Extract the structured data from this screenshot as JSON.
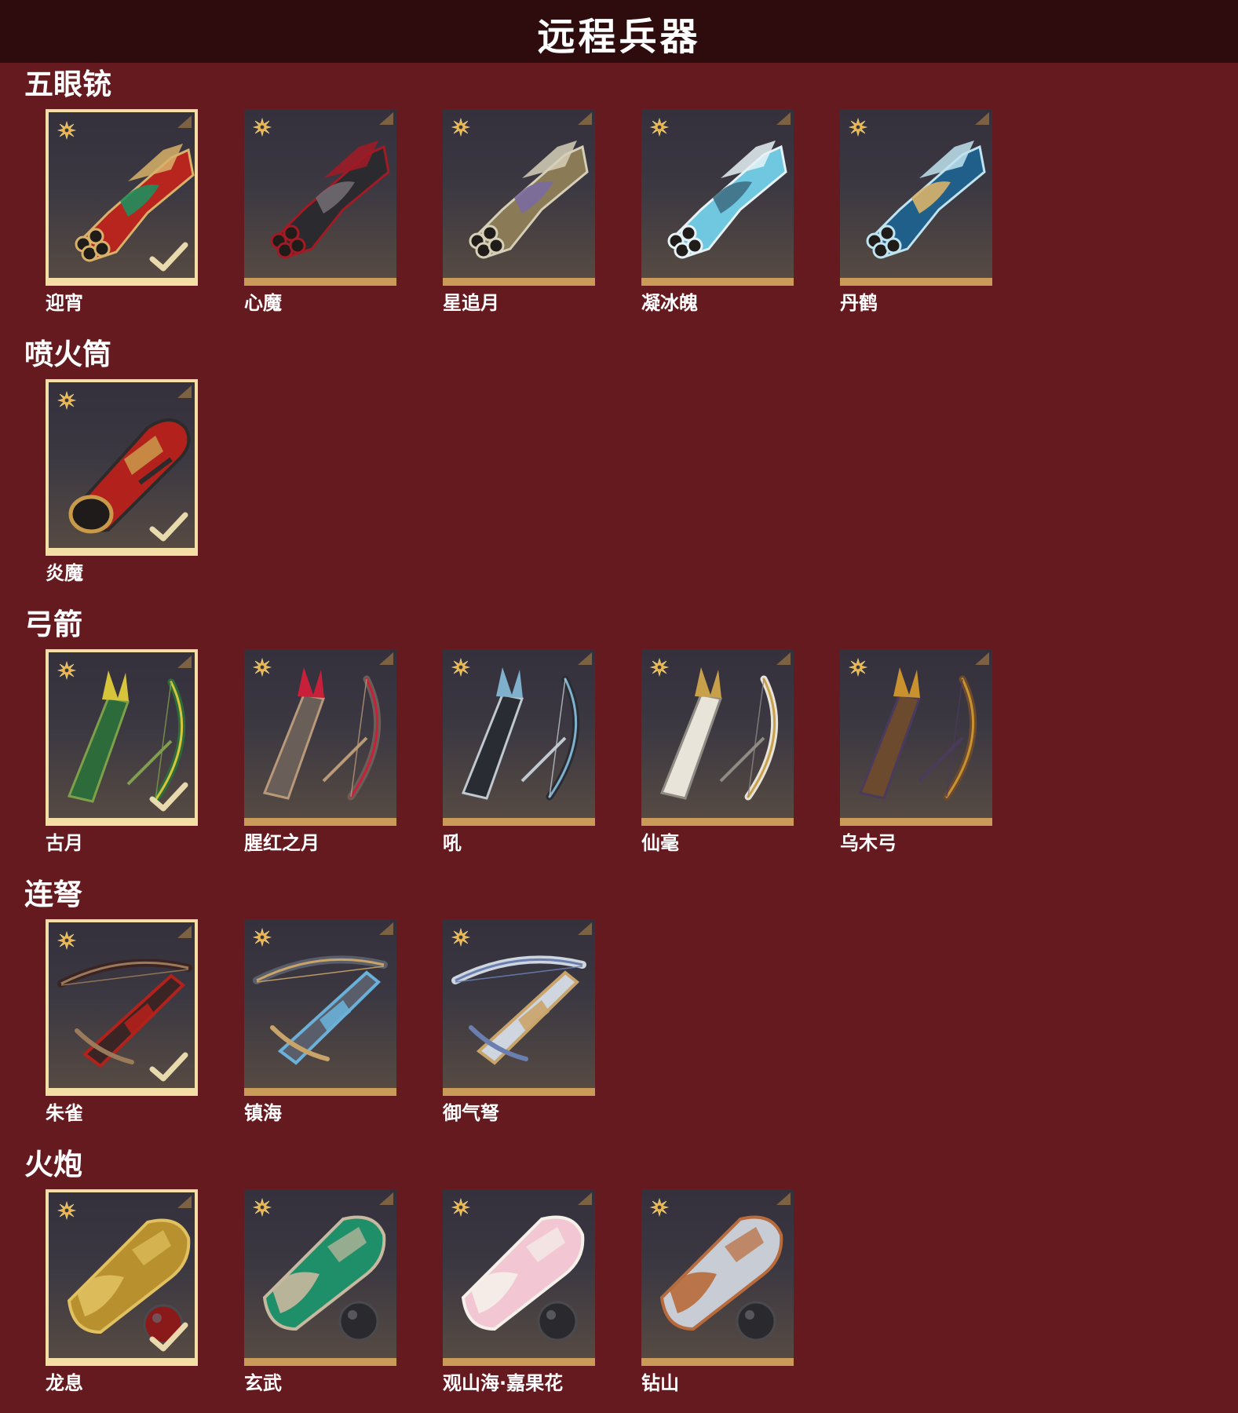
{
  "page": {
    "title": "远程兵器"
  },
  "sections": [
    {
      "title": "五眼铳",
      "items": [
        {
          "name": "迎宵",
          "selected": true,
          "kind": "gun",
          "palette": [
            "#b8241e",
            "#d8b26a",
            "#1f8f5c"
          ]
        },
        {
          "name": "心魔",
          "selected": false,
          "kind": "gun",
          "palette": [
            "#2b2a2e",
            "#a11a24",
            "#6f6a70"
          ]
        },
        {
          "name": "星追月",
          "selected": false,
          "kind": "gun",
          "palette": [
            "#8a7a55",
            "#d6cfb8",
            "#7a6aa0"
          ]
        },
        {
          "name": "凝冰魄",
          "selected": false,
          "kind": "gun",
          "palette": [
            "#6fc8e0",
            "#e6f2f6",
            "#3e6f85"
          ]
        },
        {
          "name": "丹鹤",
          "selected": false,
          "kind": "gun",
          "palette": [
            "#1f5f8a",
            "#bfe3ef",
            "#d8b26a"
          ]
        }
      ]
    },
    {
      "title": "喷火筒",
      "items": [
        {
          "name": "炎魔",
          "selected": true,
          "kind": "tube",
          "palette": [
            "#b3211c",
            "#c99a4a",
            "#2c2a2a"
          ]
        }
      ]
    },
    {
      "title": "弓箭",
      "items": [
        {
          "name": "古月",
          "selected": true,
          "kind": "bow",
          "palette": [
            "#2e6b3a",
            "#d7c43a",
            "#7ea04a"
          ]
        },
        {
          "name": "腥红之月",
          "selected": false,
          "kind": "bow",
          "palette": [
            "#6a5e58",
            "#c8203a",
            "#b89a7a"
          ]
        },
        {
          "name": "吼",
          "selected": false,
          "kind": "bow",
          "palette": [
            "#2a2c33",
            "#7fb0cc",
            "#c0c8d0"
          ]
        },
        {
          "name": "仙毫",
          "selected": false,
          "kind": "bow",
          "palette": [
            "#e8e4da",
            "#c9a04a",
            "#8e8a84"
          ]
        },
        {
          "name": "乌木弓",
          "selected": false,
          "kind": "bow",
          "palette": [
            "#6b4a2e",
            "#c9922e",
            "#4a3a5e"
          ]
        }
      ]
    },
    {
      "title": "连弩",
      "items": [
        {
          "name": "朱雀",
          "selected": true,
          "kind": "crossbow",
          "palette": [
            "#3a2424",
            "#b3211c",
            "#9a7a5a"
          ]
        },
        {
          "name": "镇海",
          "selected": false,
          "kind": "crossbow",
          "palette": [
            "#5a5e6a",
            "#6ab0d8",
            "#c9a46a"
          ]
        },
        {
          "name": "御气弩",
          "selected": false,
          "kind": "crossbow",
          "palette": [
            "#cfd6e0",
            "#c9a46a",
            "#6a7fb0"
          ]
        }
      ]
    },
    {
      "title": "火炮",
      "items": [
        {
          "name": "龙息",
          "selected": true,
          "kind": "cannon",
          "palette": [
            "#b8902e",
            "#e0c060",
            "#8a1a1a"
          ]
        },
        {
          "name": "玄武",
          "selected": false,
          "kind": "cannon",
          "palette": [
            "#1f8f6a",
            "#c8b8a0",
            "#2a2a2e"
          ]
        },
        {
          "name": "观山海·嘉果花",
          "selected": false,
          "kind": "cannon",
          "palette": [
            "#f2c6d2",
            "#f5f0ea",
            "#2a2a2e"
          ]
        },
        {
          "name": "钻山",
          "selected": false,
          "kind": "cannon",
          "palette": [
            "#c8ccd4",
            "#b86a3a",
            "#2a2a2e"
          ]
        }
      ]
    }
  ]
}
